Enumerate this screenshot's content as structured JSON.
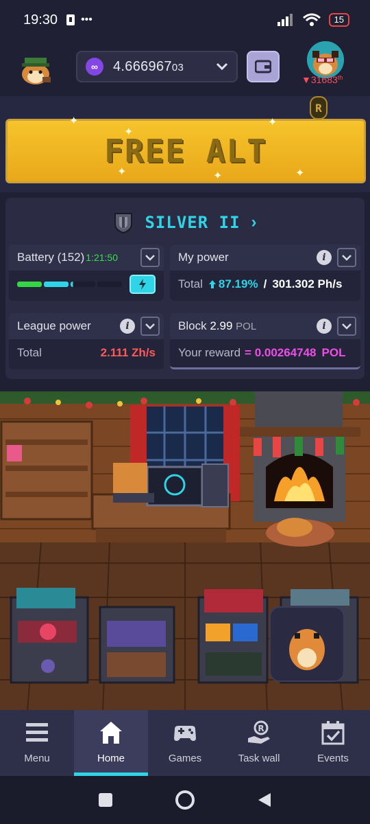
{
  "status_bar": {
    "time": "19:30",
    "extra_icons": "•••",
    "battery_level": "15"
  },
  "header": {
    "balance_main": "4.666967",
    "balance_tail": "03",
    "rank_arrow": "▼",
    "rank": "31683",
    "rank_suffix": "th"
  },
  "banner": {
    "label": "FREE ALT"
  },
  "league": {
    "name": "SILVER II"
  },
  "battery_card": {
    "title": "Battery (152)",
    "timer": "1:21:50",
    "fill_fraction": 0.42
  },
  "power_card": {
    "title": "My power",
    "total_label": "Total",
    "percent": "87.19%",
    "separator": "/",
    "value": "301.302 Ph/s"
  },
  "league_power_card": {
    "title": "League power",
    "total_label": "Total",
    "value": "2.111 Zh/s"
  },
  "block_card": {
    "title_prefix": "Block",
    "block_value": "2.99",
    "block_unit": "POL",
    "reward_label": "Your reward",
    "reward_value": "= 0.00264748",
    "reward_unit": "POL"
  },
  "bottom_nav": {
    "items": [
      {
        "label": "Menu",
        "icon": "menu-icon"
      },
      {
        "label": "Home",
        "icon": "home-icon",
        "active": true
      },
      {
        "label": "Games",
        "icon": "gamepad-icon"
      },
      {
        "label": "Task wall",
        "icon": "task-wall-icon"
      },
      {
        "label": "Events",
        "icon": "calendar-icon"
      }
    ]
  },
  "colors": {
    "accent": "#2fd4e6",
    "background": "#1f2033",
    "panel": "#2b2c44",
    "banner": "#f6c42c",
    "reward": "#ee4ee6",
    "league_power": "#ff5a5a"
  }
}
